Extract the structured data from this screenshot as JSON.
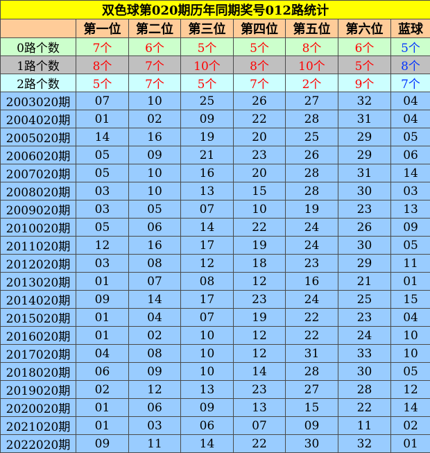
{
  "title": "双色球第020期历年同期奖号012路统计",
  "headers": [
    "",
    "第一位",
    "第二位",
    "第三位",
    "第四位",
    "第五位",
    "第六位",
    "蓝球"
  ],
  "stats": [
    {
      "label": "0路个数",
      "values": [
        "7个",
        "6个",
        "5个",
        "5个",
        "8个",
        "6个",
        "5个"
      ]
    },
    {
      "label": "1路个数",
      "values": [
        "8个",
        "7个",
        "10个",
        "8个",
        "10个",
        "5个",
        "8个"
      ]
    },
    {
      "label": "2路个数",
      "values": [
        "5个",
        "7个",
        "5个",
        "7个",
        "2个",
        "9个",
        "7个"
      ]
    }
  ],
  "rows": [
    {
      "issue": "2003020期",
      "nums": [
        "07",
        "10",
        "25",
        "26",
        "27",
        "32",
        "04"
      ]
    },
    {
      "issue": "2004020期",
      "nums": [
        "01",
        "02",
        "09",
        "22",
        "28",
        "31",
        "04"
      ]
    },
    {
      "issue": "2005020期",
      "nums": [
        "14",
        "16",
        "19",
        "20",
        "25",
        "29",
        "05"
      ]
    },
    {
      "issue": "2006020期",
      "nums": [
        "05",
        "09",
        "21",
        "23",
        "26",
        "29",
        "06"
      ]
    },
    {
      "issue": "2007020期",
      "nums": [
        "05",
        "10",
        "16",
        "20",
        "28",
        "31",
        "14"
      ]
    },
    {
      "issue": "2008020期",
      "nums": [
        "03",
        "10",
        "13",
        "15",
        "28",
        "30",
        "03"
      ]
    },
    {
      "issue": "2009020期",
      "nums": [
        "03",
        "05",
        "07",
        "10",
        "19",
        "23",
        "13"
      ]
    },
    {
      "issue": "2010020期",
      "nums": [
        "05",
        "06",
        "14",
        "22",
        "24",
        "26",
        "09"
      ]
    },
    {
      "issue": "2011020期",
      "nums": [
        "12",
        "16",
        "17",
        "19",
        "24",
        "30",
        "05"
      ]
    },
    {
      "issue": "2012020期",
      "nums": [
        "03",
        "08",
        "12",
        "18",
        "23",
        "29",
        "11"
      ]
    },
    {
      "issue": "2013020期",
      "nums": [
        "01",
        "07",
        "08",
        "12",
        "16",
        "21",
        "01"
      ]
    },
    {
      "issue": "2014020期",
      "nums": [
        "09",
        "14",
        "17",
        "23",
        "24",
        "25",
        "15"
      ]
    },
    {
      "issue": "2015020期",
      "nums": [
        "01",
        "04",
        "07",
        "19",
        "22",
        "23",
        "04"
      ]
    },
    {
      "issue": "2016020期",
      "nums": [
        "01",
        "02",
        "10",
        "12",
        "22",
        "24",
        "10"
      ]
    },
    {
      "issue": "2017020期",
      "nums": [
        "04",
        "08",
        "10",
        "12",
        "31",
        "33",
        "10"
      ]
    },
    {
      "issue": "2018020期",
      "nums": [
        "06",
        "09",
        "10",
        "14",
        "28",
        "30",
        "05"
      ]
    },
    {
      "issue": "2019020期",
      "nums": [
        "02",
        "12",
        "13",
        "23",
        "27",
        "28",
        "12"
      ]
    },
    {
      "issue": "2020020期",
      "nums": [
        "01",
        "06",
        "09",
        "13",
        "15",
        "22",
        "14"
      ]
    },
    {
      "issue": "2021020期",
      "nums": [
        "01",
        "03",
        "06",
        "07",
        "09",
        "11",
        "02"
      ]
    },
    {
      "issue": "2022020期",
      "nums": [
        "09",
        "11",
        "14",
        "22",
        "30",
        "32",
        "01"
      ]
    }
  ],
  "colors": {
    "title_bg": "#ffff00",
    "header_bg": "#ffcc99",
    "route0_bg": "#ccffcc",
    "route1_bg": "#c0c0c0",
    "route2_bg": "#ccffff",
    "data_bg": "#99ccff",
    "red_count": "#ff0000",
    "blue_count": "#0033ff"
  }
}
